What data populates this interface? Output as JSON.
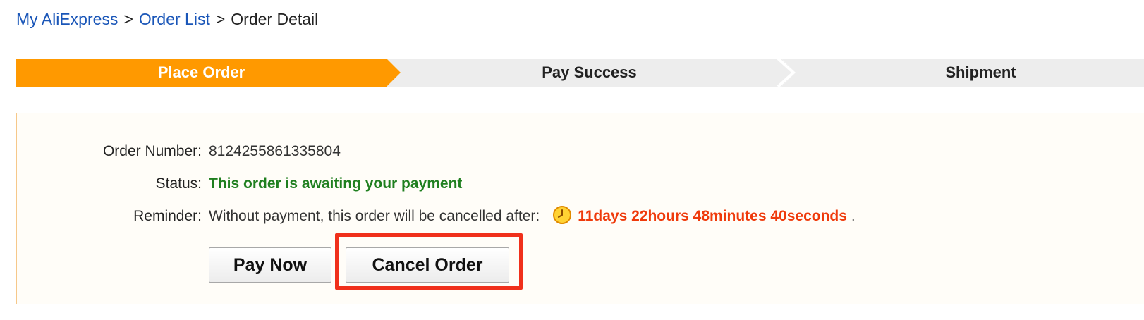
{
  "breadcrumb": {
    "items": [
      "My AliExpress",
      "Order List",
      "Order Detail"
    ],
    "separator": ">"
  },
  "steps": [
    {
      "label": "Place Order",
      "state": "active"
    },
    {
      "label": "Pay Success",
      "state": "pending"
    },
    {
      "label": "Shipment",
      "state": "pending"
    }
  ],
  "order": {
    "number_label": "Order Number:",
    "number": "8124255861335804",
    "status_label": "Status:",
    "status": "This order is awaiting your payment",
    "reminder_label": "Reminder:",
    "reminder_text": "Without payment, this order will be cancelled after:",
    "countdown": "11days 22hours 48minutes 40seconds",
    "countdown_suffix": "."
  },
  "buttons": {
    "pay_now": "Pay Now",
    "cancel_order": "Cancel Order"
  },
  "icons": {
    "clock": "clock-icon"
  },
  "colors": {
    "active_step": "#ff9900",
    "inactive_step": "#ededed",
    "link": "#1a56b8",
    "status_green": "#1f7f1f",
    "countdown_red": "#ef3a0b",
    "box_border": "#f6c88a",
    "highlight": "#f0301b"
  }
}
